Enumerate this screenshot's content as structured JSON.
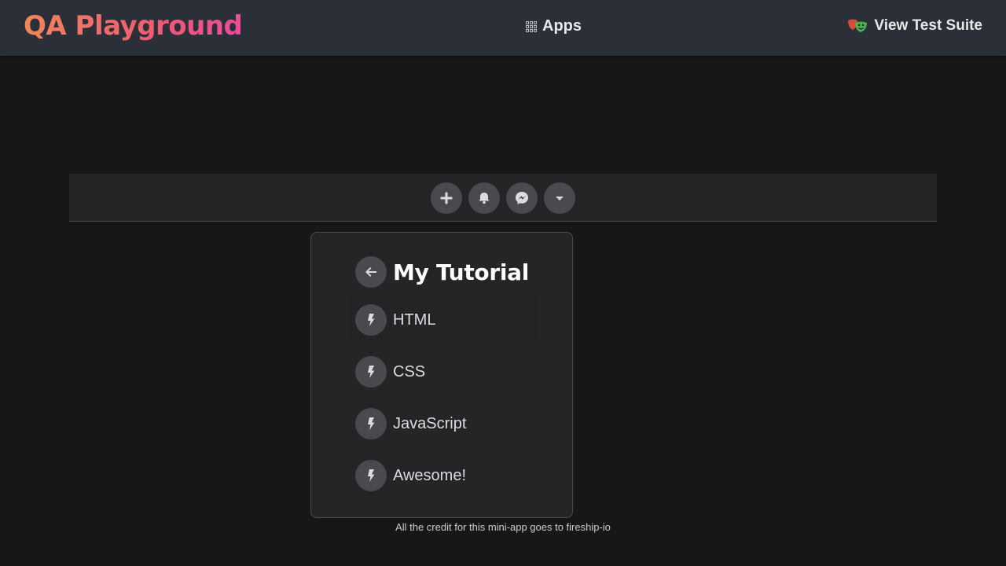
{
  "header": {
    "logo": "QA Playground",
    "apps_label": "Apps",
    "test_suite_label": "View Test Suite"
  },
  "navbar": {
    "buttons": [
      {
        "icon": "plus-icon"
      },
      {
        "icon": "bell-icon"
      },
      {
        "icon": "messenger-icon"
      },
      {
        "icon": "caret-down-icon"
      }
    ]
  },
  "dropdown": {
    "title": "My Tutorial",
    "items": [
      {
        "label": "HTML",
        "icon": "bolt-icon"
      },
      {
        "label": "CSS",
        "icon": "bolt-icon"
      },
      {
        "label": "JavaScript",
        "icon": "bolt-icon"
      },
      {
        "label": "Awesome!",
        "icon": "bolt-icon"
      }
    ]
  },
  "footer": {
    "credit": "All the credit for this mini-app goes to fireship-io"
  },
  "colors": {
    "header_bg": "#2b2f37",
    "page_bg": "#161717",
    "panel_bg": "#242526",
    "button_bg": "#484a4d",
    "logo_gradient_start": "#f2865a",
    "logo_gradient_end": "#ec4c9a"
  }
}
